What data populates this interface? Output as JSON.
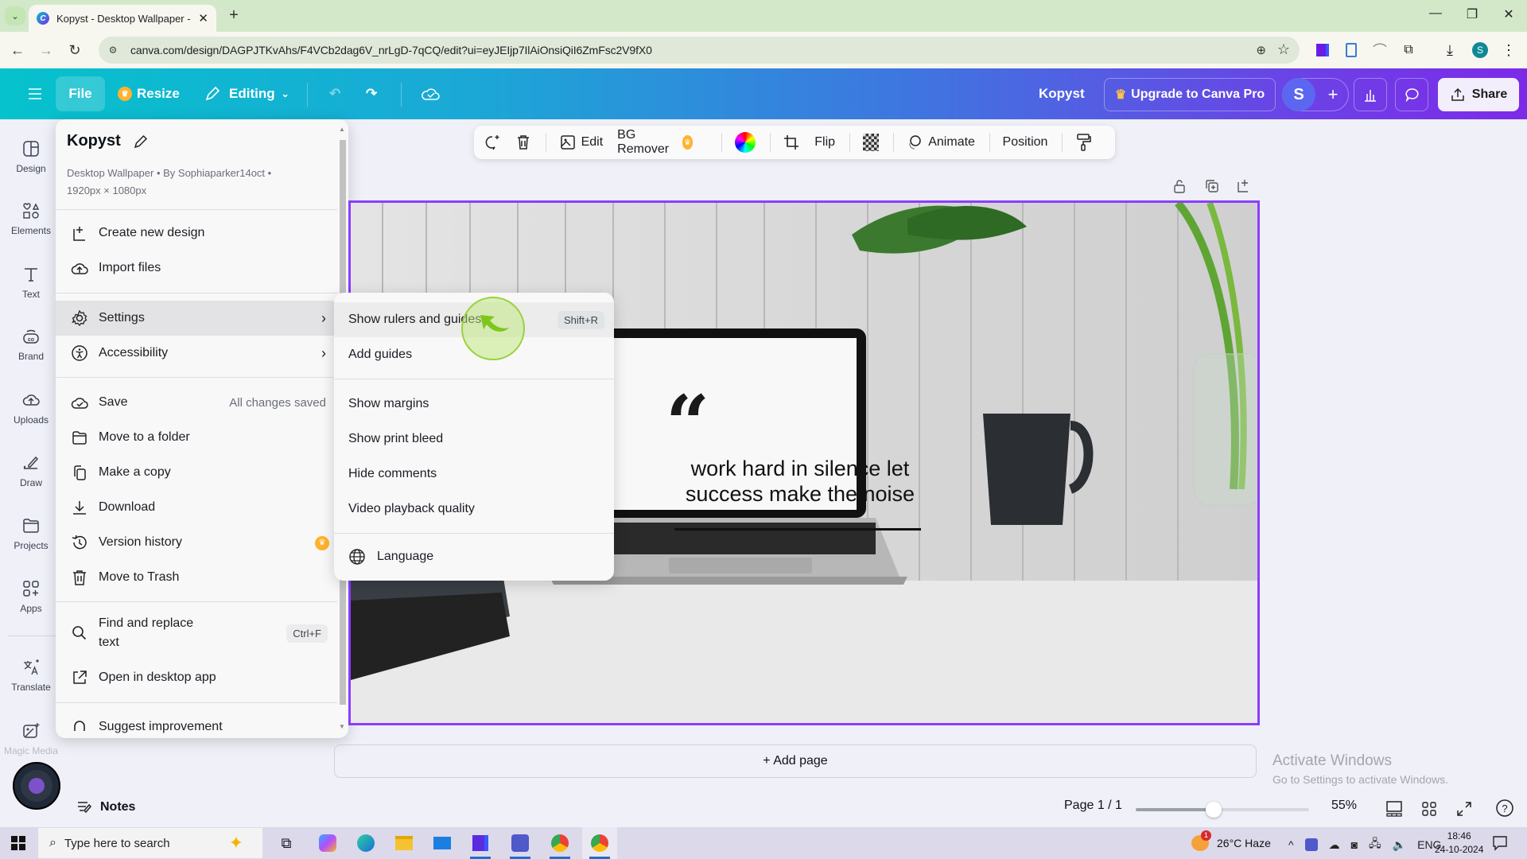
{
  "browser": {
    "tab_title": "Kopyst - Desktop Wallpaper - C",
    "new_tab": "+",
    "url": "canva.com/design/DAGPJTKvAhs/F4VCb2dag6V_nrLgD-7qCQ/edit?ui=eyJEIjp7IlAiOnsiQiI6ZmFsc2V9fX0",
    "profile_initial": "S"
  },
  "header": {
    "file": "File",
    "resize": "Resize",
    "editing": "Editing",
    "design_name": "Kopyst",
    "upgrade": "Upgrade to Canva Pro",
    "avatar_initial": "S",
    "share": "Share"
  },
  "rail": [
    {
      "label": "Design",
      "icon": "design-icon"
    },
    {
      "label": "Elements",
      "icon": "elements-icon"
    },
    {
      "label": "Text",
      "icon": "text-icon"
    },
    {
      "label": "Brand",
      "icon": "brand-icon"
    },
    {
      "label": "Uploads",
      "icon": "uploads-icon"
    },
    {
      "label": "Draw",
      "icon": "draw-icon"
    },
    {
      "label": "Projects",
      "icon": "projects-icon"
    },
    {
      "label": "Apps",
      "icon": "apps-icon"
    },
    {
      "label": "Translate",
      "icon": "translate-icon"
    },
    {
      "label": "Magic Media",
      "icon": "magic-media-icon"
    }
  ],
  "file_menu": {
    "title": "Kopyst",
    "meta_line1": "Desktop Wallpaper • By Sophiaparker14oct •",
    "meta_line2": "1920px × 1080px",
    "items": {
      "create": "Create new design",
      "import": "Import files",
      "settings": "Settings",
      "accessibility": "Accessibility",
      "save": "Save",
      "save_status": "All changes saved",
      "move_folder": "Move to a folder",
      "copy": "Make a copy",
      "download": "Download",
      "version": "Version history",
      "trash": "Move to Trash",
      "find_line1": "Find and replace",
      "find_line2": "text",
      "find_shortcut": "Ctrl+F",
      "desktop": "Open in desktop app",
      "suggest": "Suggest improvement"
    }
  },
  "settings_submenu": {
    "rulers": "Show rulers and guides",
    "rulers_shortcut": "Shift+R",
    "add_guides": "Add guides",
    "margins": "Show margins",
    "bleed": "Show print bleed",
    "comments": "Hide comments",
    "video": "Video playback quality",
    "language": "Language"
  },
  "toolbar": {
    "edit": "Edit",
    "bg_remover": "BG Remover",
    "flip": "Flip",
    "animate": "Animate",
    "position": "Position"
  },
  "canvas": {
    "quote_mark": "“",
    "quote_line1": "work hard in silence let",
    "quote_line2": "success make the noise"
  },
  "footer": {
    "add_page": "+ Add page",
    "notes": "Notes",
    "page": "Page 1 / 1",
    "zoom": "55%",
    "zoom_fraction": 0.45
  },
  "watermark": {
    "line1": "Activate Windows",
    "line2": "Go to Settings to activate Windows."
  },
  "taskbar": {
    "search_placeholder": "Type here to search",
    "weather": "26°C  Haze",
    "weather_badge": "1",
    "lang": "ENG",
    "time": "18:46",
    "date": "24-10-2024"
  }
}
